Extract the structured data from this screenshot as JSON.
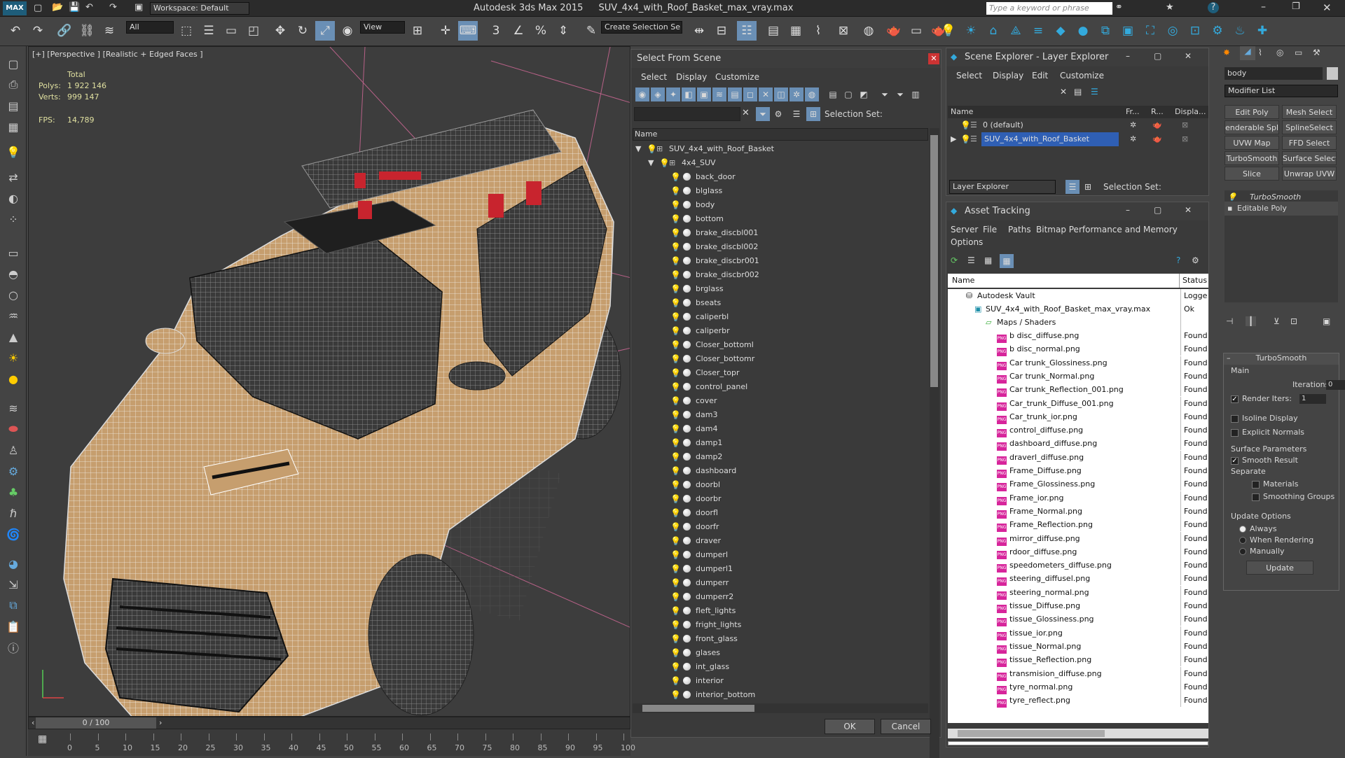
{
  "app": {
    "title": "Autodesk 3ds Max  2015",
    "file": "SUV_4x4_with_Roof_Basket_max_vray.max",
    "workspace": "Workspace: Default",
    "search_placeholder": "Type a keyword or phrase"
  },
  "toolbar": {
    "filter": "All",
    "view": "View",
    "selection_set": "Create Selection Se"
  },
  "viewport": {
    "label": "[+] [Perspective ] [Realistic + Edged Faces ]",
    "total_label": "Total",
    "polys_label": "Polys:",
    "polys_value": "1 922 146",
    "verts_label": "Verts:",
    "verts_value": "999 147",
    "fps_label": "FPS:",
    "fps_value": "14,789"
  },
  "timeline": {
    "frame": "0 / 100",
    "ticks": [
      "0",
      "5",
      "10",
      "15",
      "20",
      "25",
      "30",
      "35",
      "40",
      "45",
      "50",
      "55",
      "60",
      "65",
      "70",
      "75",
      "80",
      "85",
      "90",
      "95",
      "100"
    ]
  },
  "select_dialog": {
    "title": "Select From Scene",
    "menus": [
      "Select",
      "Display",
      "Customize"
    ],
    "selection_set_label": "Selection Set:",
    "column_name": "Name",
    "root": "SUV_4x4_with_Roof_Basket",
    "group": "4x4_SUV",
    "items": [
      "back_door",
      "blglass",
      "body",
      "bottom",
      "brake_discbl001",
      "brake_discbl002",
      "brake_discbr001",
      "brake_discbr002",
      "brglass",
      "bseats",
      "caliperbl",
      "caliperbr",
      "Closer_bottoml",
      "Closer_bottomr",
      "Closer_topr",
      "control_panel",
      "cover",
      "dam3",
      "dam4",
      "damp1",
      "damp2",
      "dashboard",
      "doorbl",
      "doorbr",
      "doorfl",
      "doorfr",
      "draver",
      "dumperl",
      "dumperl1",
      "dumperr",
      "dumperr2",
      "fleft_lights",
      "fright_lights",
      "front_glass",
      "glases",
      "int_glass",
      "interior",
      "interior_bottom"
    ],
    "ok": "OK",
    "cancel": "Cancel"
  },
  "scene_explorer": {
    "title": "Scene Explorer - Layer Explorer",
    "menus": [
      "Select",
      "Display",
      "Edit",
      "Customize"
    ],
    "columns": [
      "Name",
      "Fr...",
      "R...",
      "Displa..."
    ],
    "layers": [
      "0 (default)",
      "SUV_4x4_with_Roof_Basket"
    ],
    "footer_combo": "Layer Explorer",
    "selection_set_label": "Selection Set:"
  },
  "asset_tracking": {
    "title": "Asset Tracking",
    "menus": [
      "Server",
      "File",
      "Paths",
      "Bitmap Performance and Memory"
    ],
    "options": "Options",
    "columns": [
      "Name",
      "Status"
    ],
    "vault": "Autodesk Vault",
    "vault_status": "Logge",
    "file": "SUV_4x4_with_Roof_Basket_max_vray.max",
    "file_status": "Ok",
    "maps_folder": "Maps / Shaders",
    "maps": [
      "b disc_diffuse.png",
      "b disc_normal.png",
      "Car trunk_Glossiness.png",
      "Car trunk_Normal.png",
      "Car trunk_Reflection_001.png",
      "Car_trunk_Diffuse_001.png",
      "Car_trunk_ior.png",
      "control_diffuse.png",
      "dashboard_diffuse.png",
      "draverl_diffuse.png",
      "Frame_Diffuse.png",
      "Frame_Glossiness.png",
      "Frame_ior.png",
      "Frame_Normal.png",
      "Frame_Reflection.png",
      "mirror_diffuse.png",
      "rdoor_diffuse.png",
      "speedometers_diffuse.png",
      "steering_diffusel.png",
      "steering_normal.png",
      "tissue_Diffuse.png",
      "tissue_Glossiness.png",
      "tissue_ior.png",
      "tissue_Normal.png",
      "tissue_Reflection.png",
      "transmision_diffuse.png",
      "tyre_normal.png",
      "tyre_reflect.png"
    ],
    "found": "Found"
  },
  "command_panel": {
    "object_name": "body",
    "modifier_list": "Modifier List",
    "buttons": [
      "Edit Poly",
      "Mesh Select",
      "enderable Splir",
      "SplineSelect",
      "UVW Map",
      "FFD Select",
      "TurboSmooth",
      "Surface Select",
      "Slice",
      "Unwrap UVW"
    ],
    "stack": [
      "TurboSmooth",
      "Editable Poly"
    ],
    "rollout_title": "TurboSmooth",
    "main_label": "Main",
    "iterations_label": "Iterations:",
    "iterations_value": "0",
    "render_iters_label": "Render Iters:",
    "render_iters_value": "1",
    "isoline": "Isoline Display",
    "explicit": "Explicit Normals",
    "surface_params": "Surface Parameters",
    "smooth_result": "Smooth Result",
    "separate": "Separate",
    "materials": "Materials",
    "smoothing_groups": "Smoothing Groups",
    "update_options": "Update Options",
    "always": "Always",
    "when_rendering": "When Rendering",
    "manually": "Manually",
    "update": "Update"
  }
}
